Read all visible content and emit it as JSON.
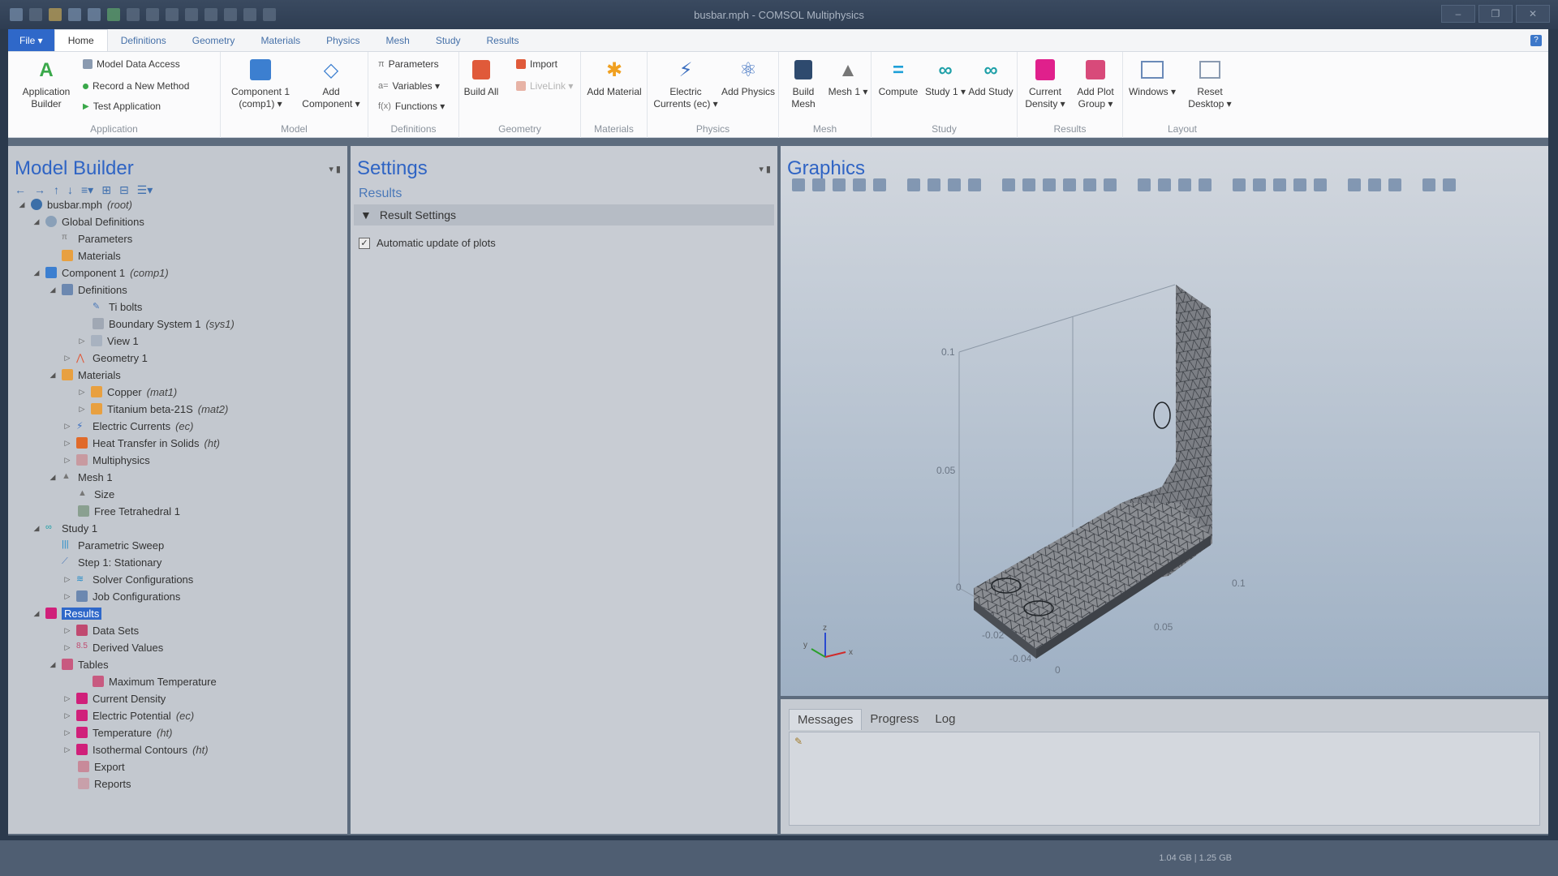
{
  "window": {
    "title": "busbar.mph - COMSOL Multiphysics"
  },
  "tabs": {
    "file": "File ▾",
    "items": [
      "Home",
      "Definitions",
      "Geometry",
      "Materials",
      "Physics",
      "Mesh",
      "Study",
      "Results"
    ]
  },
  "ribbon": {
    "application": {
      "label": "Application",
      "builder": "Application Builder",
      "model_data_access": "Model Data Access",
      "record_method": "Record a New Method",
      "test_application": "Test Application"
    },
    "model": {
      "label": "Model",
      "component": "Component 1 (comp1) ▾",
      "add_component": "Add Component ▾"
    },
    "definitions": {
      "label": "Definitions",
      "parameters": "Parameters",
      "variables": "Variables ▾",
      "functions": "Functions ▾"
    },
    "geometry": {
      "label": "Geometry",
      "build_all": "Build All",
      "import": "Import",
      "livelink": "LiveLink ▾"
    },
    "materials": {
      "label": "Materials",
      "add_material": "Add Material"
    },
    "physics": {
      "label": "Physics",
      "electric_currents": "Electric Currents (ec) ▾",
      "add_physics": "Add Physics"
    },
    "mesh": {
      "label": "Mesh",
      "build_mesh": "Build Mesh",
      "mesh1": "Mesh 1 ▾"
    },
    "study": {
      "label": "Study",
      "compute": "Compute",
      "study1": "Study 1 ▾",
      "add_study": "Add Study"
    },
    "results": {
      "label": "Results",
      "current_density": "Current Density ▾",
      "add_plot_group": "Add Plot Group ▾"
    },
    "layout": {
      "label": "Layout",
      "windows": "Windows ▾",
      "reset_desktop": "Reset Desktop ▾"
    }
  },
  "model_builder": {
    "title": "Model Builder",
    "tree": [
      {
        "label": "busbar.mph",
        "tag": "(root)"
      },
      {
        "label": "Global Definitions",
        "tag": ""
      },
      {
        "label": "Parameters",
        "tag": ""
      },
      {
        "label": "Materials",
        "tag": ""
      },
      {
        "label": "Component 1",
        "tag": "(comp1)"
      },
      {
        "label": "Definitions",
        "tag": ""
      },
      {
        "label": "Ti bolts",
        "tag": ""
      },
      {
        "label": "Boundary System 1",
        "tag": "(sys1)"
      },
      {
        "label": "View 1",
        "tag": ""
      },
      {
        "label": "Geometry 1",
        "tag": ""
      },
      {
        "label": "Materials",
        "tag": ""
      },
      {
        "label": "Copper",
        "tag": "(mat1)"
      },
      {
        "label": "Titanium beta-21S",
        "tag": "(mat2)"
      },
      {
        "label": "Electric Currents",
        "tag": "(ec)"
      },
      {
        "label": "Heat Transfer in Solids",
        "tag": "(ht)"
      },
      {
        "label": "Multiphysics",
        "tag": ""
      },
      {
        "label": "Mesh 1",
        "tag": ""
      },
      {
        "label": "Size",
        "tag": ""
      },
      {
        "label": "Free Tetrahedral 1",
        "tag": ""
      },
      {
        "label": "Study 1",
        "tag": ""
      },
      {
        "label": "Parametric Sweep",
        "tag": ""
      },
      {
        "label": "Step 1: Stationary",
        "tag": ""
      },
      {
        "label": "Solver Configurations",
        "tag": ""
      },
      {
        "label": "Job Configurations",
        "tag": ""
      },
      {
        "label": "Results",
        "tag": ""
      },
      {
        "label": "Data Sets",
        "tag": ""
      },
      {
        "label": "Derived Values",
        "tag": ""
      },
      {
        "label": "Tables",
        "tag": ""
      },
      {
        "label": "Maximum Temperature",
        "tag": ""
      },
      {
        "label": "Current Density",
        "tag": ""
      },
      {
        "label": "Electric Potential",
        "tag": "(ec)"
      },
      {
        "label": "Temperature",
        "tag": "(ht)"
      },
      {
        "label": "Isothermal Contours",
        "tag": "(ht)"
      },
      {
        "label": "Export",
        "tag": ""
      },
      {
        "label": "Reports",
        "tag": ""
      }
    ]
  },
  "settings": {
    "title": "Settings",
    "subtitle": "Results",
    "section": "Result Settings",
    "checkbox_label": "Automatic update of plots",
    "checkbox_checked": true
  },
  "graphics": {
    "title": "Graphics",
    "axis_labels": {
      "z_top": "0.1",
      "z_mid": "0.05",
      "z_zero": "0",
      "x_right": "0.1",
      "x_mid": "0.05",
      "y_a": "-0.02",
      "y_b": "-0.04",
      "y_zero": "0"
    },
    "triad": {
      "x": "x",
      "y": "y",
      "z": "z"
    }
  },
  "messages": {
    "tabs": [
      "Messages",
      "Progress",
      "Log"
    ]
  },
  "status": {
    "memory": "1.04 GB | 1.25 GB"
  }
}
